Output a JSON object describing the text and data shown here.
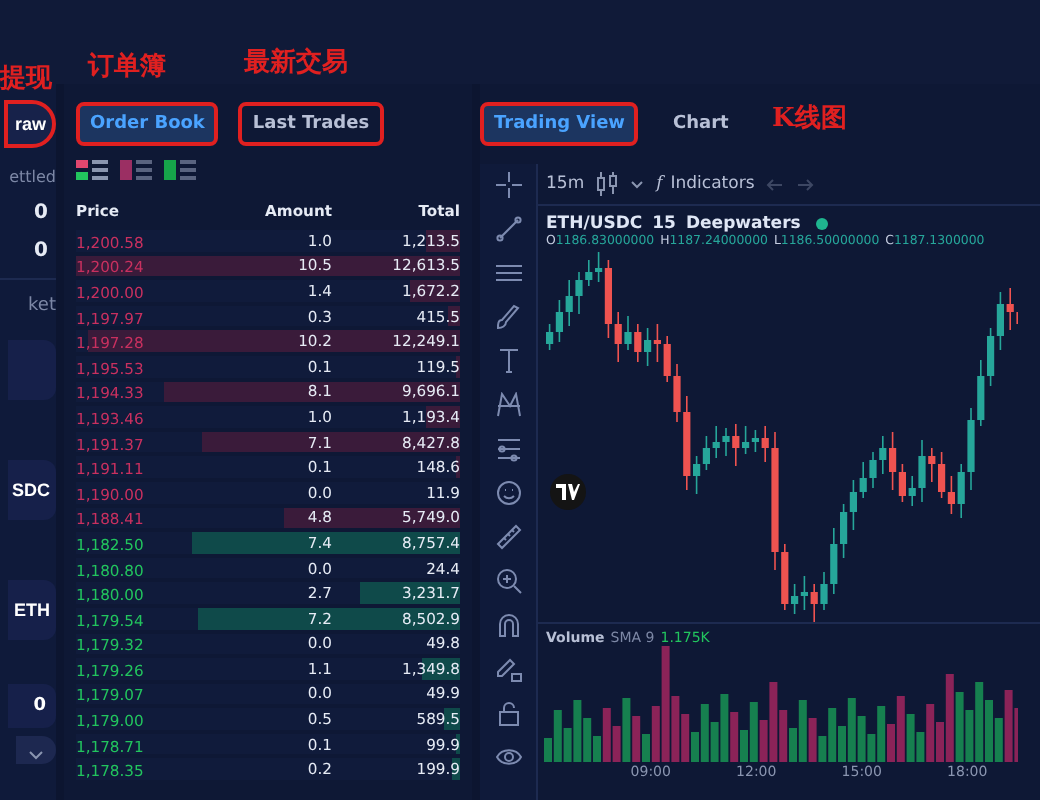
{
  "annotations": [
    {
      "label": "提现"
    },
    {
      "label": "订单簿"
    },
    {
      "label": "最新交易"
    },
    {
      "label": "K线图"
    }
  ],
  "account": {
    "withdraw_button": "raw",
    "settled_label": "ettled",
    "balances": [
      "0",
      "0"
    ],
    "market_label": "ket",
    "assets": [
      "SDC",
      "ETH"
    ],
    "amount": "0"
  },
  "order_book": {
    "tabs": [
      {
        "label": "Order Book",
        "selected": true,
        "annotated": true
      },
      {
        "label": "Last Trades",
        "selected": false,
        "annotated": true
      }
    ],
    "columns": [
      "Price",
      "Amount",
      "Total"
    ],
    "rows": [
      {
        "kind": "ask",
        "price": "1,200.58",
        "amount": "1.0",
        "total": "1,213.5",
        "level": 0.09
      },
      {
        "kind": "ask",
        "price": "1,200.24",
        "amount": "10.5",
        "total": "12,613.5",
        "level": 1.0
      },
      {
        "kind": "ask",
        "price": "1,200.00",
        "amount": "1.4",
        "total": "1,672.2",
        "level": 0.13
      },
      {
        "kind": "ask",
        "price": "1,197.97",
        "amount": "0.3",
        "total": "415.5",
        "level": 0.03
      },
      {
        "kind": "ask",
        "price": "1,197.28",
        "amount": "10.2",
        "total": "12,249.1",
        "level": 0.97
      },
      {
        "kind": "ask",
        "price": "1,195.53",
        "amount": "0.1",
        "total": "119.5",
        "level": 0.01
      },
      {
        "kind": "ask",
        "price": "1,194.33",
        "amount": "8.1",
        "total": "9,696.1",
        "level": 0.77
      },
      {
        "kind": "ask",
        "price": "1,193.46",
        "amount": "1.0",
        "total": "1,193.4",
        "level": 0.09
      },
      {
        "kind": "ask",
        "price": "1,191.37",
        "amount": "7.1",
        "total": "8,427.8",
        "level": 0.67
      },
      {
        "kind": "ask",
        "price": "1,191.11",
        "amount": "0.1",
        "total": "148.6",
        "level": 0.01
      },
      {
        "kind": "ask",
        "price": "1,190.00",
        "amount": "0.0",
        "total": "11.9"
      },
      {
        "kind": "ask",
        "price": "1,188.41",
        "amount": "4.8",
        "total": "5,749.0",
        "level": 0.46
      },
      {
        "kind": "bid",
        "price": "1,182.50",
        "amount": "7.4",
        "total": "8,757.4",
        "level": 0.7
      },
      {
        "kind": "bid",
        "price": "1,180.80",
        "amount": "0.0",
        "total": "24.4"
      },
      {
        "kind": "bid",
        "price": "1,180.00",
        "amount": "2.7",
        "total": "3,231.7",
        "level": 0.26
      },
      {
        "kind": "bid",
        "price": "1,179.54",
        "amount": "7.2",
        "total": "8,502.9",
        "level": 0.68
      },
      {
        "kind": "bid",
        "price": "1,179.32",
        "amount": "0.0",
        "total": "49.8"
      },
      {
        "kind": "bid",
        "price": "1,179.26",
        "amount": "1.1",
        "total": "1,349.8",
        "level": 0.1
      },
      {
        "kind": "bid",
        "price": "1,179.07",
        "amount": "0.0",
        "total": "49.9"
      },
      {
        "kind": "bid",
        "price": "1,179.00",
        "amount": "0.5",
        "total": "589.5",
        "level": 0.04
      },
      {
        "kind": "bid",
        "price": "1,178.71",
        "amount": "0.1",
        "total": "99.9",
        "level": 0.01
      },
      {
        "kind": "bid",
        "price": "1,178.35",
        "amount": "0.2",
        "total": "199.9",
        "level": 0.02
      }
    ]
  },
  "chart_panel": {
    "tabs": [
      {
        "label": "Trading View",
        "selected": true,
        "annotated": true
      },
      {
        "label": "Chart",
        "selected": false,
        "annotated": false
      }
    ],
    "interval": "15m",
    "function_icon": "f",
    "indicators_button": "Indicators",
    "legend": {
      "symbol": "ETH/USDC",
      "interval": "15",
      "source": "Deepwaters",
      "ohlc": [
        {
          "key": "O",
          "value": "1186.83000000"
        },
        {
          "key": "H",
          "value": "1187.24000000"
        },
        {
          "key": "L",
          "value": "1186.50000000"
        },
        {
          "key": "C",
          "value": "1187.1300000"
        }
      ]
    },
    "volume": {
      "label": "Volume",
      "indicator": "SMA 9",
      "value": "1.175K"
    },
    "time_labels": [
      "09:00",
      "12:00",
      "15:00",
      "18:00"
    ]
  }
}
